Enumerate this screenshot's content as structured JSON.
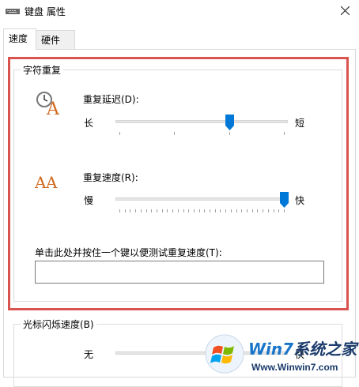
{
  "window": {
    "title": "键盘 属性",
    "close_glyph": "✕"
  },
  "tabs": [
    {
      "label": "速度",
      "selected": true
    },
    {
      "label": "硬件",
      "selected": false
    }
  ],
  "char_repeat": {
    "legend": "字符重复",
    "delay": {
      "label": "重复延迟(D):",
      "min_label": "长",
      "max_label": "短",
      "value_fraction": 0.66,
      "icon": "clock-a-icon"
    },
    "rate": {
      "label": "重复速度(R):",
      "min_label": "慢",
      "max_label": "快",
      "value_fraction": 1.0,
      "icon": "double-a-icon"
    },
    "test": {
      "label": "单击此处并按住一个键以便测试重复速度(T):",
      "value": ""
    }
  },
  "cursor_blink": {
    "legend": "光标闪烁速度(B)",
    "min_label": "无",
    "max_label": "快"
  },
  "watermark": {
    "brand_win": "Win7",
    "brand_rest": "系统之家",
    "url": "Www.Winwin7.com"
  },
  "colors": {
    "accent": "#0078d7",
    "highlight": "#d9534f",
    "brand": "#1a75c9"
  }
}
